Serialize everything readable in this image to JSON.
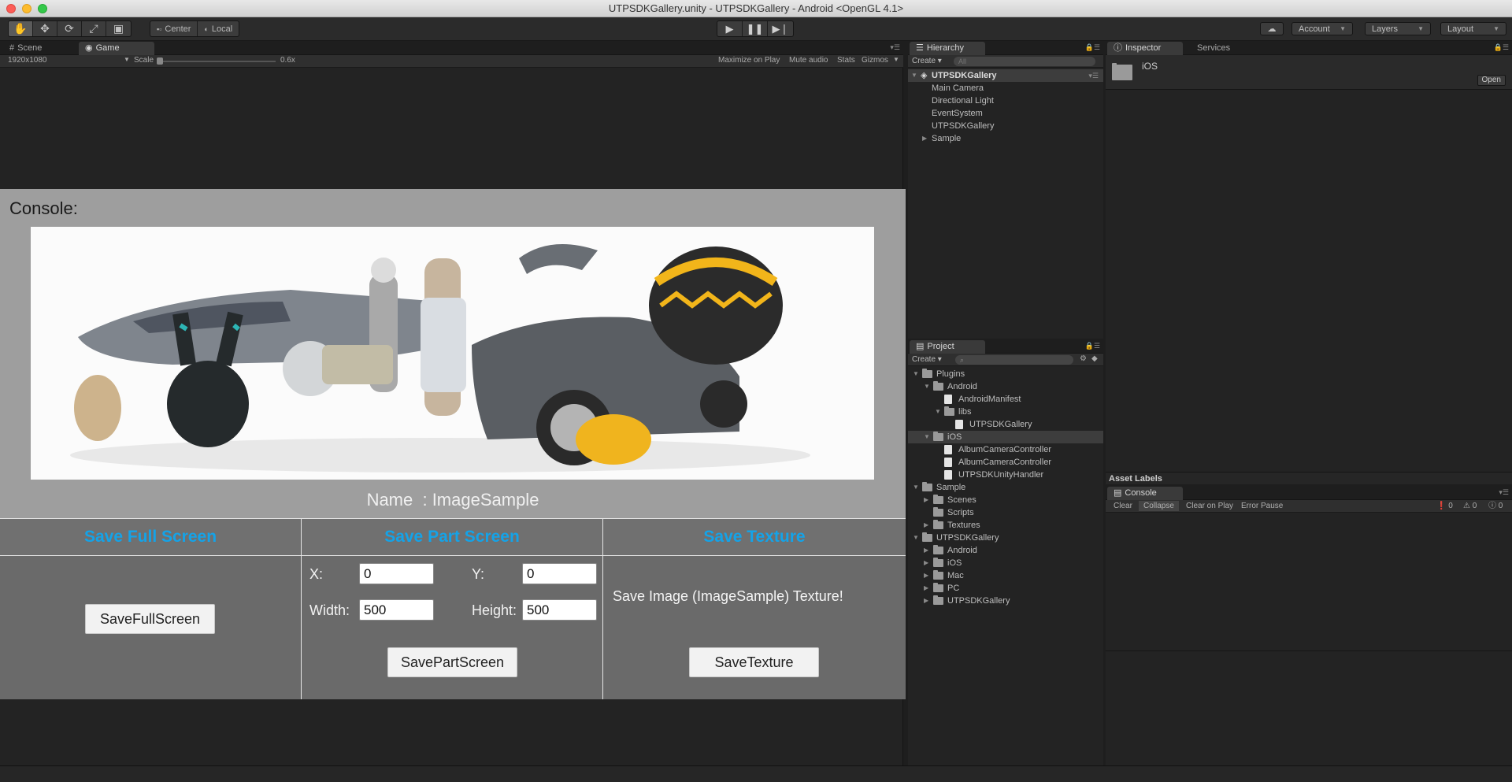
{
  "window": {
    "title": "UTPSDKGallery.unity - UTPSDKGallery - Android <OpenGL 4.1>"
  },
  "toolbar": {
    "tools": [
      "hand-icon",
      "move-icon",
      "rotate-icon",
      "scale-icon",
      "rect-icon"
    ],
    "pivot_center": "Center",
    "pivot_local": "Local",
    "account": "Account",
    "layers": "Layers",
    "layout": "Layout"
  },
  "scene_tabs": {
    "scene": "Scene",
    "game": "Game"
  },
  "game_bar": {
    "resolution": "1920x1080",
    "scale_label": "Scale",
    "scale_value": "0.6x",
    "maximize": "Maximize on Play",
    "mute": "Mute audio",
    "stats": "Stats",
    "gizmos": "Gizmos"
  },
  "game": {
    "console_label": "Console:",
    "name_label": "Name  : ImageSample",
    "columns": {
      "full": {
        "title": "Save Full Screen",
        "button": "SaveFullScreen"
      },
      "part": {
        "title": "Save Part Screen",
        "x_label": "X:",
        "x_value": "0",
        "y_label": "Y:",
        "y_value": "0",
        "width_label": "Width:",
        "width_value": "500",
        "height_label": "Height:",
        "height_value": "500",
        "button": "SavePartScreen"
      },
      "texture": {
        "title": "Save Texture",
        "message": "Save Image (ImageSample) Texture!",
        "button": "SaveTexture"
      }
    }
  },
  "hierarchy": {
    "tab": "Hierarchy",
    "create": "Create",
    "search_placeholder": "All",
    "scene": "UTPSDKGallery",
    "items": [
      "Main Camera",
      "Directional Light",
      "EventSystem",
      "UTPSDKGallery",
      "Sample"
    ]
  },
  "project": {
    "tab": "Project",
    "create": "Create",
    "tree": [
      {
        "label": "Plugins",
        "level": 0,
        "type": "folder",
        "open": true
      },
      {
        "label": "Android",
        "level": 1,
        "type": "folder",
        "open": true
      },
      {
        "label": "AndroidManifest",
        "level": 2,
        "type": "file"
      },
      {
        "label": "libs",
        "level": 2,
        "type": "folder",
        "open": true
      },
      {
        "label": "UTPSDKGallery",
        "level": 3,
        "type": "file"
      },
      {
        "label": "iOS",
        "level": 1,
        "type": "folder",
        "open": true,
        "selected": true
      },
      {
        "label": "AlbumCameraController",
        "level": 2,
        "type": "file"
      },
      {
        "label": "AlbumCameraController",
        "level": 2,
        "type": "file"
      },
      {
        "label": "UTPSDKUnityHandler",
        "level": 2,
        "type": "file"
      },
      {
        "label": "Sample",
        "level": 0,
        "type": "folder",
        "open": true
      },
      {
        "label": "Scenes",
        "level": 1,
        "type": "folder",
        "open": false
      },
      {
        "label": "Scripts",
        "level": 1,
        "type": "folder"
      },
      {
        "label": "Textures",
        "level": 1,
        "type": "folder",
        "open": false
      },
      {
        "label": "UTPSDKGallery",
        "level": 0,
        "type": "folder",
        "open": true
      },
      {
        "label": "Android",
        "level": 1,
        "type": "folder",
        "open": false
      },
      {
        "label": "iOS",
        "level": 1,
        "type": "folder",
        "open": false
      },
      {
        "label": "Mac",
        "level": 1,
        "type": "folder",
        "open": false
      },
      {
        "label": "PC",
        "level": 1,
        "type": "folder",
        "open": false
      },
      {
        "label": "UTPSDKGallery",
        "level": 1,
        "type": "folder",
        "open": false
      }
    ]
  },
  "inspector": {
    "tab": "Inspector",
    "services_tab": "Services",
    "asset_name": "iOS",
    "open_button": "Open"
  },
  "asset_labels": "Asset Labels",
  "console": {
    "tab": "Console",
    "clear": "Clear",
    "collapse": "Collapse",
    "clear_on_play": "Clear on Play",
    "error_pause": "Error Pause",
    "log_count": "0",
    "warn_count": "0",
    "error_count": "0"
  },
  "colors": {
    "accent": "#14a3e8",
    "panel": "#232323",
    "canvas": "#9e9e9e"
  }
}
